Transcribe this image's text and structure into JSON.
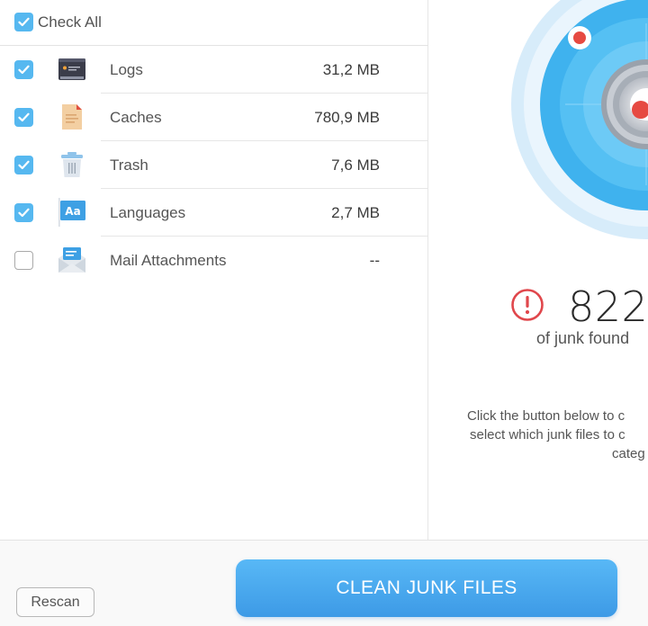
{
  "check_all": {
    "label": "Check All",
    "checked": true
  },
  "items": [
    {
      "name": "Logs",
      "size": "31,2 MB",
      "checked": true,
      "icon": "console-icon"
    },
    {
      "name": "Caches",
      "size": "780,9 MB",
      "checked": true,
      "icon": "document-icon"
    },
    {
      "name": "Trash",
      "size": "7,6 MB",
      "checked": true,
      "icon": "trash-icon"
    },
    {
      "name": "Languages",
      "size": "2,7 MB",
      "checked": true,
      "icon": "language-icon"
    },
    {
      "name": "Mail Attachments",
      "size": "--",
      "checked": false,
      "icon": "mail-icon"
    }
  ],
  "summary": {
    "junk_size": "822,",
    "caption": "of junk found",
    "instructions": [
      "Click the button below to c",
      "select which junk files to c",
      "categ"
    ]
  },
  "buttons": {
    "rescan": "Rescan",
    "clean": "CLEAN JUNK FILES"
  },
  "colors": {
    "accent": "#56b8f0",
    "alert": "#e0474c",
    "button": "#4aa8ee"
  }
}
